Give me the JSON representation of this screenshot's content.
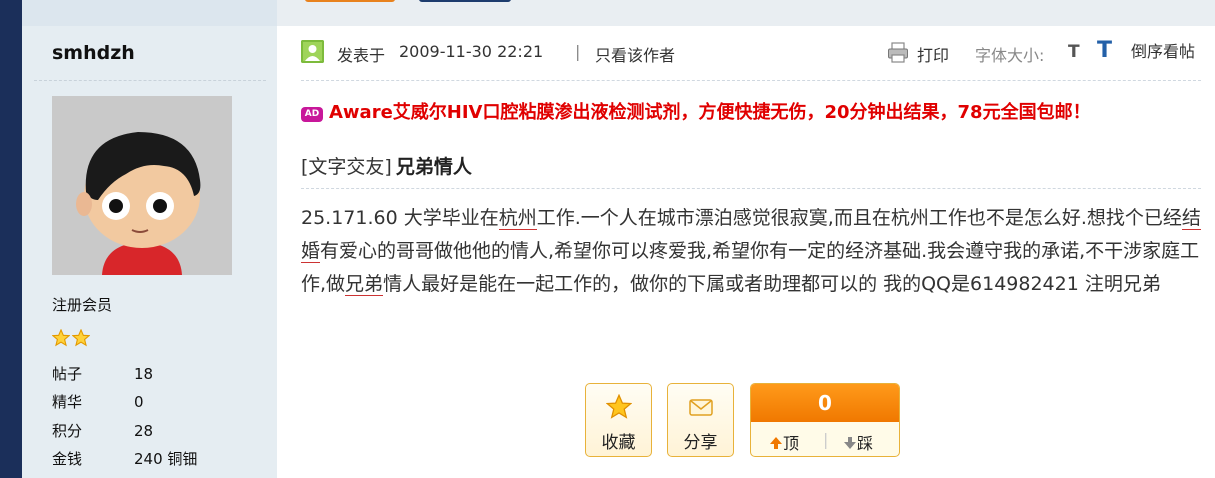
{
  "user": {
    "username": "smhdzh",
    "group": "注册会员",
    "stats": [
      {
        "label": "帖子",
        "value": "18"
      },
      {
        "label": "精华",
        "value": "0"
      },
      {
        "label": "积分",
        "value": "28"
      },
      {
        "label": "金钱",
        "value": "240 铜钿"
      }
    ]
  },
  "post": {
    "posted_label": "发表于",
    "time": "2009-11-30 22:21",
    "separator": "|",
    "only_author": "只看该作者",
    "print": "打印",
    "font_size_label": "字体大小:",
    "font_small": "T",
    "font_large": "T",
    "reverse_order": "倒序看帖",
    "ad_badge": "AD",
    "ad_text": "Aware艾威尔HIV口腔粘膜渗出液检测试剂，方便快捷无伤，20分钟出结果，78元全国包邮！",
    "category": "[文字交友]",
    "title": "兄弟情人",
    "body": {
      "p1": "25.171.60 大学毕业在",
      "u1": "杭州",
      "p2": "工作.一个人在城市漂泊感觉很寂寞,而且在杭州工作也不是怎么好.想找个已经",
      "u2": "结婚",
      "p3": "有爱心的哥哥做他他的情人,希望你可以疼爱我,希望你有一定的经济基础.我会遵守我的承诺,不干涉家庭工作,做",
      "u3": "兄弟",
      "p4": "情人最好是能在一起工作的，做你的下属或者助理都可以的  我的QQ是614982421 注明兄弟"
    }
  },
  "actions": {
    "favorite": "收藏",
    "share": "分享",
    "vote_count": "0",
    "up": "顶",
    "separator": "|",
    "down": "踩"
  },
  "colors": {
    "ad_red": "#e00000",
    "accent_orange": "#f07800",
    "sidebar_bg": "#e5edf2",
    "nav_dark": "#1b2f5a",
    "link_blue": "#2360a8"
  }
}
